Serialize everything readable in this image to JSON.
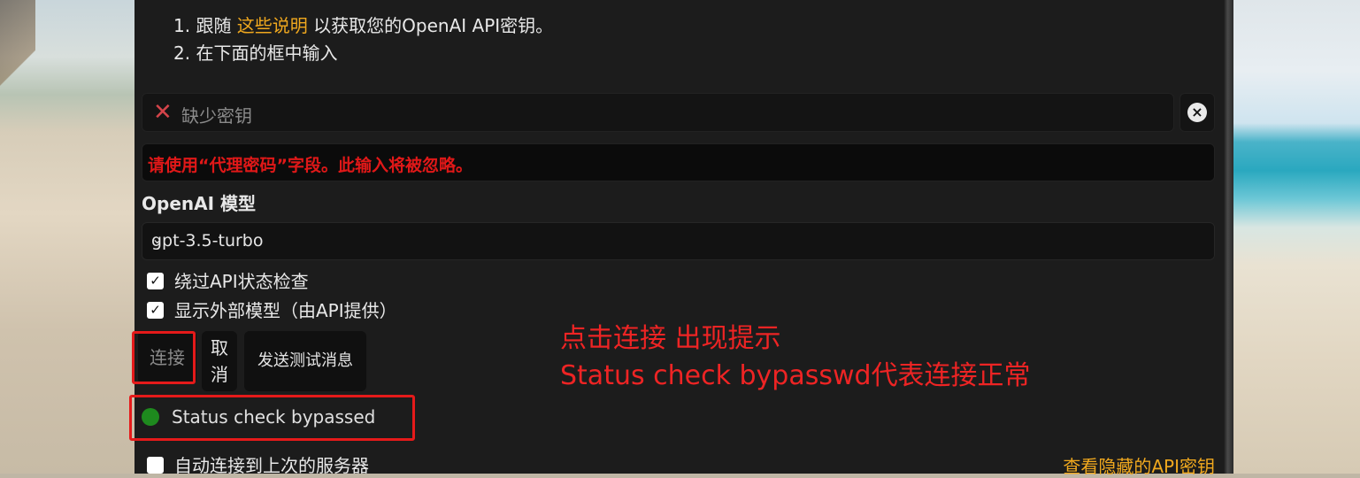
{
  "instructions": {
    "step1_prefix": "1. 跟随 ",
    "step1_link": "这些说明",
    "step1_suffix": " 以获取您的OpenAI API密钥。",
    "step2": "2. 在下面的框中输入"
  },
  "api_key": {
    "status_text": "缺少密钥",
    "clear_icon": "close-circle-icon"
  },
  "warning": "请使用“代理密码”字段。此输入将被忽略。",
  "model": {
    "label": "OpenAI 模型",
    "selected": "gpt-3.5-turbo"
  },
  "checkboxes": [
    {
      "label": "绕过API状态检查",
      "checked": true
    },
    {
      "label": "显示外部模型（由API提供）",
      "checked": true
    }
  ],
  "buttons": {
    "connect": "连接",
    "cancel_line1": "取",
    "cancel_line2": "消",
    "send_test": "发送测试消息"
  },
  "status": {
    "text": "Status check bypassed",
    "color": "#1e8a1e"
  },
  "auto_connect": {
    "label": "自动连接到上次的服务器",
    "checked": false
  },
  "view_hidden_keys": "查看隐藏的API密钥",
  "annotation": {
    "line1": "点击连接 出现提示",
    "line2": "Status check bypasswd代表连接正常"
  },
  "colors": {
    "accent_link": "#f0a81e",
    "warning_red": "#e01818",
    "annotation_red": "#ee2424",
    "panel_bg": "#1c1c1c"
  }
}
